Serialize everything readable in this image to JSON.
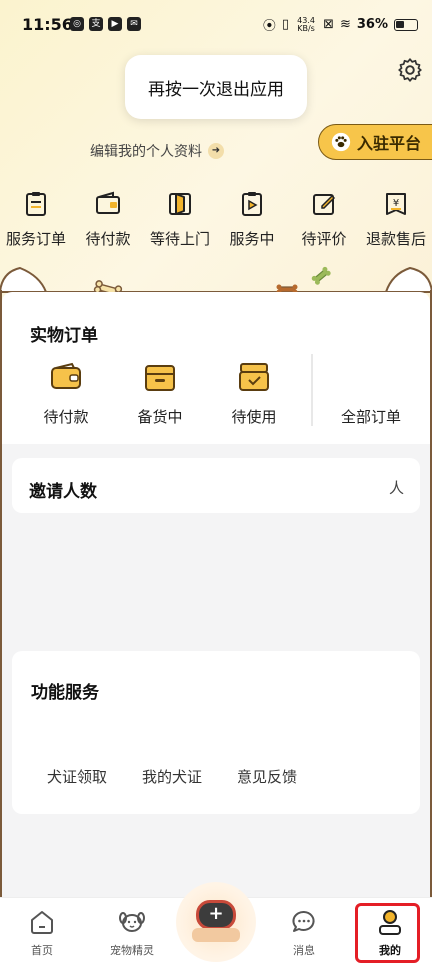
{
  "status": {
    "time": "11:56",
    "net_speed_value": "43.4",
    "net_speed_unit": "KB/s",
    "battery": "36%"
  },
  "toast": "再按一次退出应用",
  "profile": {
    "edit_label": "编辑我的个人资料",
    "join_label": "入驻平台"
  },
  "orders": [
    {
      "label": "服务订单",
      "icon": "clipboard-icon"
    },
    {
      "label": "待付款",
      "icon": "wallet-icon"
    },
    {
      "label": "等待上门",
      "icon": "door-icon"
    },
    {
      "label": "服务中",
      "icon": "play-clipboard-icon"
    },
    {
      "label": "待评价",
      "icon": "edit-icon"
    },
    {
      "label": "退款售后",
      "icon": "refund-icon"
    }
  ],
  "goods": {
    "title": "实物订单",
    "items": [
      {
        "label": "待付款",
        "icon": "wallet-icon"
      },
      {
        "label": "备货中",
        "icon": "box-icon"
      },
      {
        "label": "待使用",
        "icon": "check-box-icon"
      },
      {
        "label": "全部订单"
      }
    ]
  },
  "invite": {
    "title": "邀请人数",
    "unit": "人"
  },
  "services": {
    "title": "功能服务",
    "links": [
      "犬证领取",
      "我的犬证",
      "意见反馈"
    ]
  },
  "tabs": [
    {
      "label": "首页",
      "icon": "home-icon"
    },
    {
      "label": "宠物精灵",
      "icon": "dog-face-icon"
    },
    {
      "label": "消息",
      "icon": "chat-icon"
    },
    {
      "label": "我的",
      "icon": "person-icon"
    }
  ],
  "colors": {
    "accent": "#f7c54a",
    "highlight": "#e41e26"
  }
}
